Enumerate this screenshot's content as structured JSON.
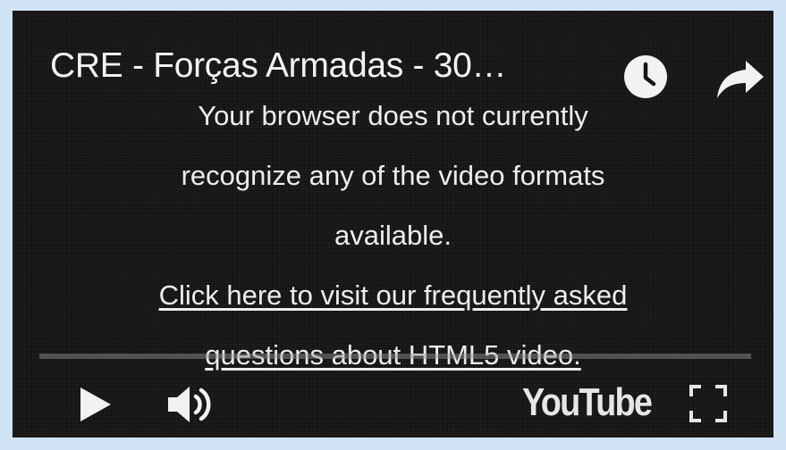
{
  "page": {
    "frame_color": "#cfe3f5",
    "player_background": "#141414"
  },
  "video": {
    "title": "CRE - Forças Armadas - 30…"
  },
  "top_controls": {
    "watch_later_icon": "clock-icon",
    "share_icon": "share-arrow-icon"
  },
  "error_message": {
    "line1": "Your browser does not currently",
    "line2": "recognize any of the video formats",
    "line3": "available.",
    "link_line1": "Click here to visit our frequently asked",
    "link_line2": "questions about HTML5 video."
  },
  "bottom_controls": {
    "play_icon": "play-icon",
    "volume_icon": "volume-icon",
    "logo_text": "YouTube",
    "fullscreen_icon": "fullscreen-icon"
  }
}
